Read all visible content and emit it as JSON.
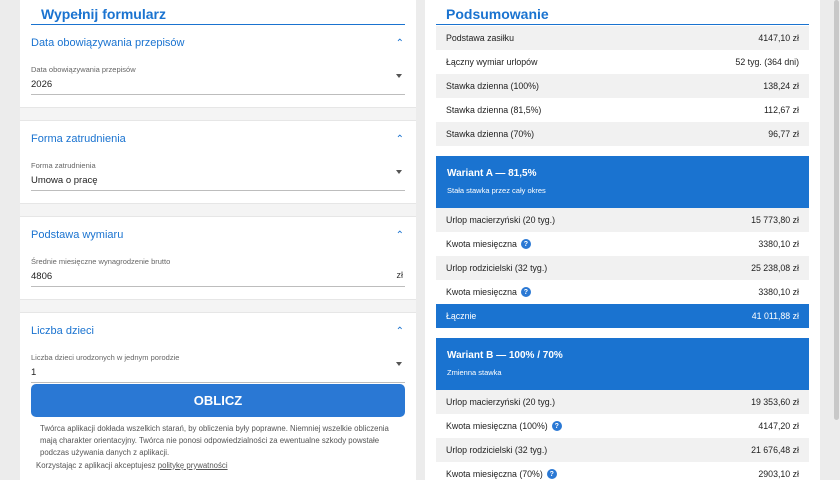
{
  "form": {
    "title": "Wypełnij formularz",
    "sections": [
      {
        "heading": "Data obowiązywania przepisów",
        "field_label": "Data obowiązywania przepisów",
        "value": "2026"
      },
      {
        "heading": "Forma zatrudnienia",
        "field_label": "Forma zatrudnienia",
        "value": "Umowa o pracę"
      },
      {
        "heading": "Podstawa wymiaru",
        "field_label": "Średnie miesięczne wynagrodzenie brutto",
        "value": "4806",
        "unit": "zł"
      },
      {
        "heading": "Liczba dzieci",
        "field_label": "Liczba dzieci urodzonych w jednym porodzie",
        "value": "1"
      }
    ],
    "calc_button": "OBLICZ",
    "disclaimer_1": "Twórca aplikacji dokłada wszelkich starań, by obliczenia były poprawne. Niemniej wszelkie obliczenia mają charakter orientacyjny. Twórca nie ponosi odpowiedzialności za ewentualne szkody powstałe podczas używania danych z aplikacji.",
    "disclaimer_2_prefix": "Korzystając z aplikacji akceptujesz ",
    "privacy_link": "politykę prywatności"
  },
  "summary": {
    "title": "Podsumowanie",
    "rows": [
      {
        "label": "Podstawa zasiłku",
        "value": "4147,10 zł"
      },
      {
        "label": "Łączny wymiar urlopów",
        "value": "52 tyg. (364 dni)"
      },
      {
        "label": "Stawka dzienna (100%)",
        "value": "138,24 zł"
      },
      {
        "label": "Stawka dzienna (81,5%)",
        "value": "112,67 zł"
      },
      {
        "label": "Stawka dzienna (70%)",
        "value": "96,77 zł"
      }
    ],
    "variant_a": {
      "title": "Wariant A — 81,5%",
      "subtitle": "Stała stawka przez cały okres",
      "rows": [
        {
          "label": "Urlop macierzyński (20 tyg.)",
          "value": "15 773,80 zł"
        },
        {
          "label": "Kwota miesięczna",
          "value": "3380,10 zł"
        },
        {
          "label": "Urlop rodzicielski (32 tyg.)",
          "value": "25 238,08 zł"
        },
        {
          "label": "Kwota miesięczna",
          "value": "3380,10 zł"
        }
      ],
      "total_label": "Łącznie",
      "total_value": "41 011,88 zł"
    },
    "variant_b": {
      "title": "Wariant B — 100% / 70%",
      "subtitle": "Zmienna stawka",
      "rows": [
        {
          "label": "Urlop macierzyński (20 tyg.)",
          "value": "19 353,60 zł"
        },
        {
          "label": "Kwota miesięczna (100%)",
          "value": "4147,20 zł"
        },
        {
          "label": "Urlop rodzicielski (32 tyg.)",
          "value": "21 676,48 zł"
        },
        {
          "label": "Kwota miesięczna (70%)",
          "value": "2903,10 zł"
        }
      ]
    },
    "help_glyph": "?"
  }
}
